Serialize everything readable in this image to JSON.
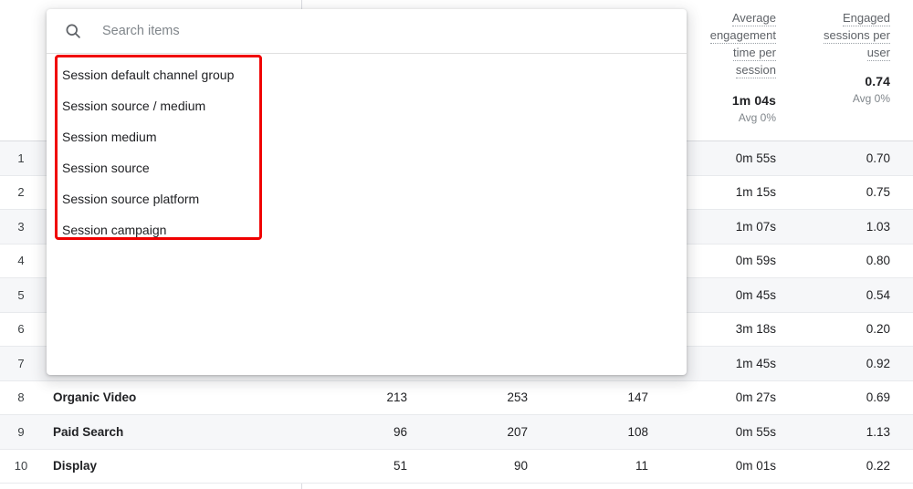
{
  "popup": {
    "search": {
      "placeholder": "Search items",
      "value": "",
      "icon": "search-icon"
    },
    "items": [
      {
        "label": "Session default channel group"
      },
      {
        "label": "Session source / medium"
      },
      {
        "label": "Session medium"
      },
      {
        "label": "Session source"
      },
      {
        "label": "Session source platform"
      },
      {
        "label": "Session campaign"
      }
    ],
    "highlight_color": "#f00000"
  },
  "table": {
    "metric_columns": [
      {
        "title_lines": [
          "Average",
          "engagement",
          "time per",
          "session"
        ],
        "total": "1m 04s",
        "subtotal": "Avg 0%"
      },
      {
        "title_lines": [
          "Engaged",
          "sessions per",
          "user"
        ],
        "total": "0.74",
        "subtotal": "Avg 0%"
      }
    ],
    "rows": [
      {
        "index": "1",
        "label": "",
        "c1": "",
        "c2": "",
        "c3": "",
        "c4": "0m 55s",
        "c5": "0.70"
      },
      {
        "index": "2",
        "label": "",
        "c1": "",
        "c2": "",
        "c3": "",
        "c4": "1m 15s",
        "c5": "0.75"
      },
      {
        "index": "3",
        "label": "",
        "c1": "",
        "c2": "",
        "c3": "",
        "c4": "1m 07s",
        "c5": "1.03"
      },
      {
        "index": "4",
        "label": "",
        "c1": "",
        "c2": "",
        "c3": "",
        "c4": "0m 59s",
        "c5": "0.80"
      },
      {
        "index": "5",
        "label": "",
        "c1": "",
        "c2": "",
        "c3": "",
        "c4": "0m 45s",
        "c5": "0.54"
      },
      {
        "index": "6",
        "label": "",
        "c1": "",
        "c2": "",
        "c3": "",
        "c4": "3m 18s",
        "c5": "0.20"
      },
      {
        "index": "7",
        "label": "",
        "c1": "",
        "c2": "",
        "c3": "",
        "c4": "1m 45s",
        "c5": "0.92"
      },
      {
        "index": "8",
        "label": "Organic Video",
        "c1": "213",
        "c2": "253",
        "c3": "147",
        "c4": "0m 27s",
        "c5": "0.69"
      },
      {
        "index": "9",
        "label": "Paid Search",
        "c1": "96",
        "c2": "207",
        "c3": "108",
        "c4": "0m 55s",
        "c5": "1.13"
      },
      {
        "index": "10",
        "label": "Display",
        "c1": "51",
        "c2": "90",
        "c3": "11",
        "c4": "0m 01s",
        "c5": "0.22"
      }
    ]
  }
}
